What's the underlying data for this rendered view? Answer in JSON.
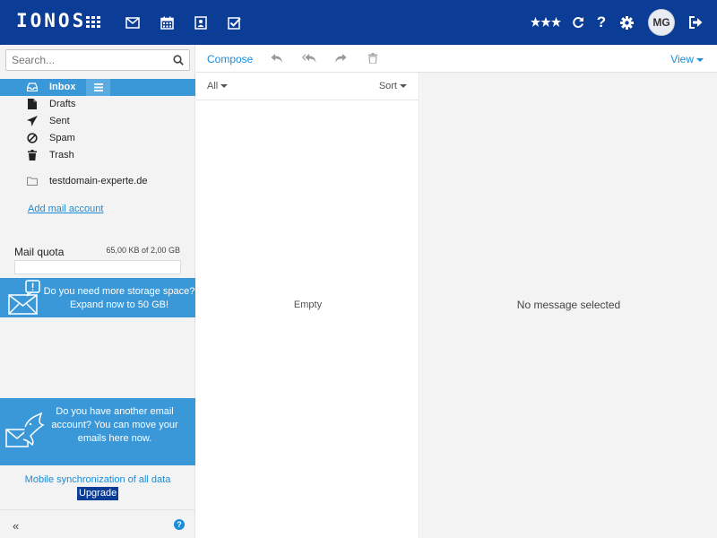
{
  "header": {
    "logo": "IONOS",
    "apps": [
      "apps-grid-icon",
      "mail-icon",
      "calendar-icon",
      "contacts-icon",
      "tasks-icon"
    ],
    "actions": [
      "stars-icon",
      "refresh-icon",
      "help-icon",
      "settings-icon"
    ],
    "user_initials": "MG",
    "logout_icon": "logout-icon",
    "brand_color": "#0b3c96"
  },
  "sidebar": {
    "search_placeholder": "Search...",
    "folders": [
      {
        "label": "Inbox",
        "icon": "inbox-icon",
        "active": true
      },
      {
        "label": "Drafts",
        "icon": "draft-icon"
      },
      {
        "label": "Sent",
        "icon": "sent-icon"
      },
      {
        "label": "Spam",
        "icon": "spam-icon"
      },
      {
        "label": "Trash",
        "icon": "trash-icon"
      }
    ],
    "account_folder": "testdomain-experte.de",
    "add_account": "Add mail account",
    "quota": {
      "label": "Mail quota",
      "value": "65,00 KB of 2,00 GB",
      "used_fraction": 0.0
    },
    "promo_storage": "Do you need more storage space? Expand now to 50 GB!",
    "promo_move": "Do you have another email account? You can move your emails here now.",
    "mobile_sync": "Mobile synchronization of all data",
    "upgrade": "Upgrade",
    "collapse": "«",
    "help": "?",
    "accent_color": "#3a98d8"
  },
  "toolbar": {
    "compose": "Compose",
    "view": "View"
  },
  "list": {
    "filter": "All",
    "sort": "Sort",
    "empty": "Empty"
  },
  "reading": {
    "no_message": "No message selected"
  }
}
